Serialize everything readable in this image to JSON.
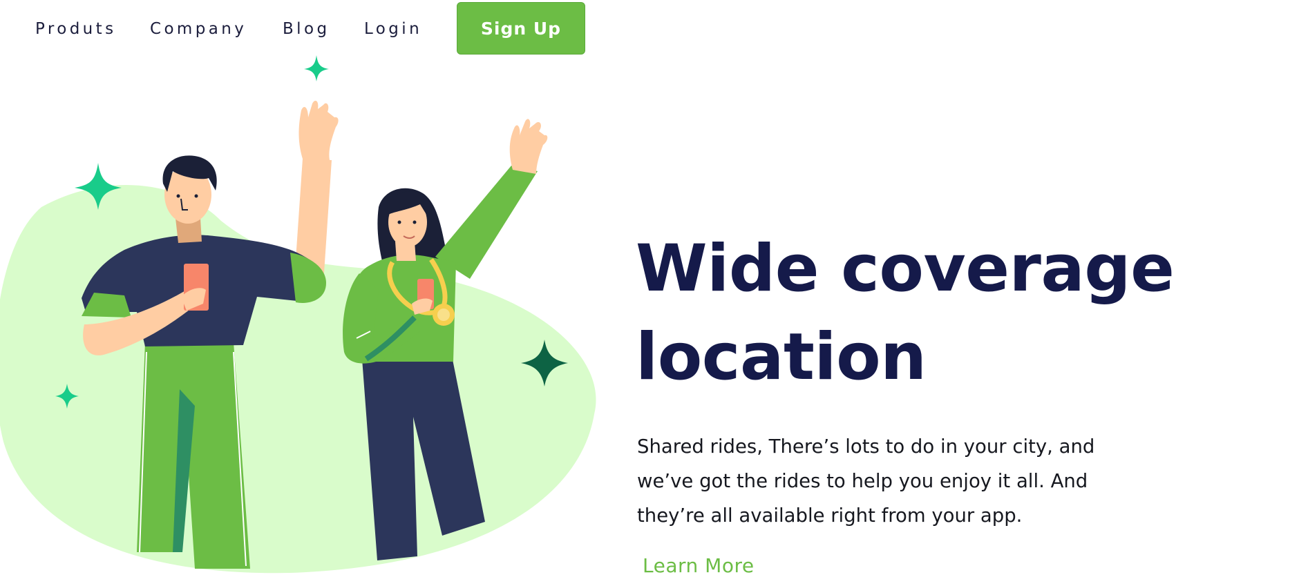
{
  "nav": {
    "links": [
      "Produts",
      "Company",
      "Blog",
      "Login"
    ],
    "signup_label": "Sign Up"
  },
  "hero": {
    "title_line1": "Wide coverage",
    "title_line2": "location",
    "description": "Shared rides, There’s lots to do in your city, and we’ve got the rides to help you enjoy it all. And they’re all available right from your app.",
    "cta_label": "Learn More"
  },
  "colors": {
    "accent_green": "#6cbd45",
    "heading_navy": "#151a4a",
    "blob_light_green": "#d9fccb",
    "sparkle_teal": "#19cc8a",
    "sparkle_dark": "#0d6344"
  },
  "illustration": {
    "icons": [
      "sparkle-icon",
      "man-waving-figure",
      "woman-waving-figure",
      "medal-icon",
      "phone-icon"
    ]
  }
}
